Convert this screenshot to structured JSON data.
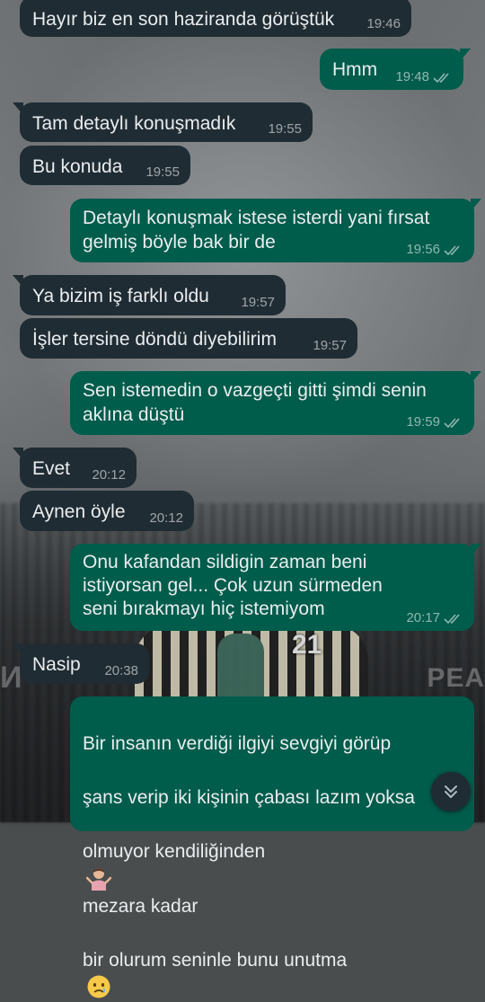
{
  "chat": {
    "messages": [
      {
        "dir": "in",
        "text": "Hayır biz en son haziranda görüştük",
        "time": "19:46"
      },
      {
        "dir": "out",
        "text": "Hmm",
        "time": "19:48",
        "status": "read"
      },
      {
        "dir": "in",
        "text": "Tam detaylı konuşmadık",
        "time": "19:55"
      },
      {
        "dir": "in",
        "text": "Bu konuda",
        "time": "19:55"
      },
      {
        "dir": "out",
        "text": "Detaylı konuşmak istese isterdi yani fırsat\ngelmiş böyle bak bir de",
        "time": "19:56",
        "status": "read"
      },
      {
        "dir": "in",
        "text": "Ya bizim iş farklı oldu",
        "time": "19:57"
      },
      {
        "dir": "in",
        "text": "İşler tersine döndü diyebilirim",
        "time": "19:57"
      },
      {
        "dir": "out",
        "text": "Sen istemedin o vazgeçti gitti şimdi senin\naklına düştü",
        "time": "19:59",
        "status": "read"
      },
      {
        "dir": "in",
        "text": "Evet",
        "time": "20:12"
      },
      {
        "dir": "in",
        "text": "Aynen öyle",
        "time": "20:12"
      },
      {
        "dir": "out",
        "text": "Onu kafandan sildigin zaman beni\nistiyorsan gel... Çok uzun sürmeden\nseni bırakmayı hiç istemiyom",
        "time": "20:17",
        "status": "read"
      },
      {
        "dir": "in",
        "text": "Nasip",
        "time": "20:38"
      },
      {
        "dir": "out",
        "text_lines": [
          "Bir insanın verdiği ilgiyi sevgiyi görüp",
          "şans verip iki kişinin çabası lazım yoksa",
          "olmuyor kendiliğinden",
          "mezara kadar",
          "bir olurum seninle bunu unutma"
        ],
        "emojis": [
          "person-shrugging-emoji",
          "crying-face-emoji"
        ]
      }
    ]
  },
  "wallpaper": {
    "jersey_number": "21",
    "watermark_left": "И",
    "watermark_right": "PEA"
  },
  "icons": {
    "read_receipt": "double-check-icon",
    "scroll_down": "chevron-double-down-icon"
  },
  "colors": {
    "incoming_bubble": "#202c33",
    "outgoing_bubble": "#005c4b",
    "text": "#e9edef",
    "meta_text": "#9aa3a8"
  }
}
